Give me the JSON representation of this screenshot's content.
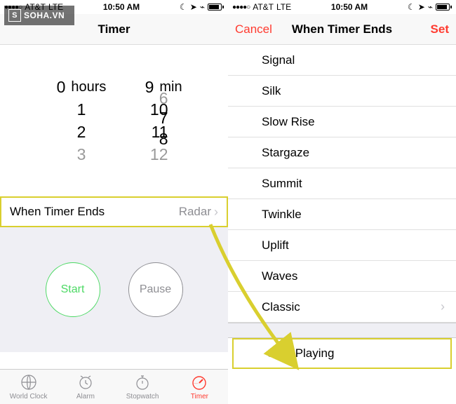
{
  "watermark": "SOHA.VN",
  "status": {
    "carrier": "AT&T",
    "network": "LTE",
    "time": "10:50 AM"
  },
  "left_screen": {
    "nav_title": "Timer",
    "picker": {
      "hours_value": "0",
      "hours_label": "hours",
      "hours_below": [
        "1",
        "2",
        "3"
      ],
      "min_above": [
        "6",
        "7",
        "8"
      ],
      "min_value": "9",
      "min_label": "min",
      "min_below": [
        "10",
        "11",
        "12"
      ]
    },
    "when_ends": {
      "label": "When Timer Ends",
      "value": "Radar"
    },
    "buttons": {
      "start": "Start",
      "pause": "Pause"
    },
    "tabs": {
      "world_clock": "World Clock",
      "alarm": "Alarm",
      "stopwatch": "Stopwatch",
      "timer": "Timer"
    }
  },
  "right_screen": {
    "cancel": "Cancel",
    "title": "When Timer Ends",
    "set": "Set",
    "sounds": [
      "Signal",
      "Silk",
      "Slow Rise",
      "Stargaze",
      "Summit",
      "Twinkle",
      "Uplift",
      "Waves",
      "Classic"
    ],
    "stop_playing": "Stop Playing"
  }
}
